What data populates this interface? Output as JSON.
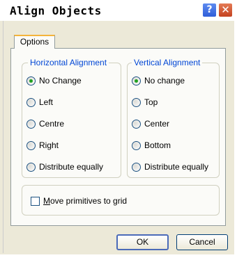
{
  "window": {
    "title": "Align Objects",
    "help_glyph": "?",
    "close_glyph": "✕"
  },
  "tabs": [
    {
      "label": "Options"
    }
  ],
  "horizontal": {
    "label": "Horizontal Alignment",
    "options": [
      "No Change",
      "Left",
      "Centre",
      "Right",
      "Distribute equally"
    ],
    "selected": "No Change"
  },
  "vertical": {
    "label": "Vertical Alignment",
    "options": [
      "No change",
      "Top",
      "Center",
      "Bottom",
      "Distribute equally"
    ],
    "selected": "No change"
  },
  "grid": {
    "mnemonic": "M",
    "label_rest": "ove primitives to grid",
    "checked": false
  },
  "buttons": {
    "ok": "OK",
    "cancel": "Cancel"
  },
  "colors": {
    "group_label": "#0046d5",
    "tab_highlight": "#f4b43a",
    "radio_dot": "#21a121"
  }
}
